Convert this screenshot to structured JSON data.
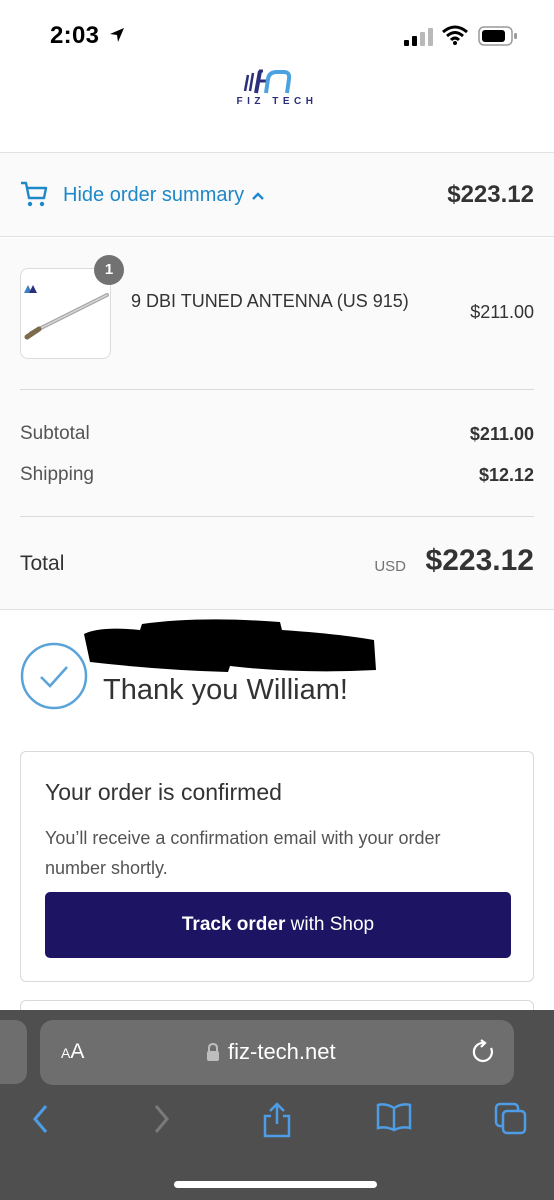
{
  "status_bar": {
    "time": "2:03"
  },
  "header": {
    "logo_text": "FIZ TECH"
  },
  "order_summary": {
    "toggle_label": "Hide order summary",
    "total": "$223.12",
    "item": {
      "quantity": "1",
      "name": "9 DBI TUNED ANTENNA (US 915)",
      "price": "$211.00",
      "thumb_brand": "MIRBALL MICROWAVE"
    },
    "subtotal_label": "Subtotal",
    "subtotal_value": "$211.00",
    "shipping_label": "Shipping",
    "shipping_value": "$12.12",
    "total_label": "Total",
    "currency": "USD",
    "total_value": "$223.12"
  },
  "thank_you": {
    "message": "Thank you William!"
  },
  "confirmation": {
    "title": "Your order is confirmed",
    "body": "You’ll receive a confirmation email with your order number shortly.",
    "track_strong": "Track order",
    "track_rest": " with Shop"
  },
  "browser": {
    "aa_small": "A",
    "aa_large": "A",
    "url": "fiz-tech.net"
  },
  "colors": {
    "accent": "#1e88c9",
    "button": "#1d1563",
    "brand": "#2c2f7a"
  }
}
